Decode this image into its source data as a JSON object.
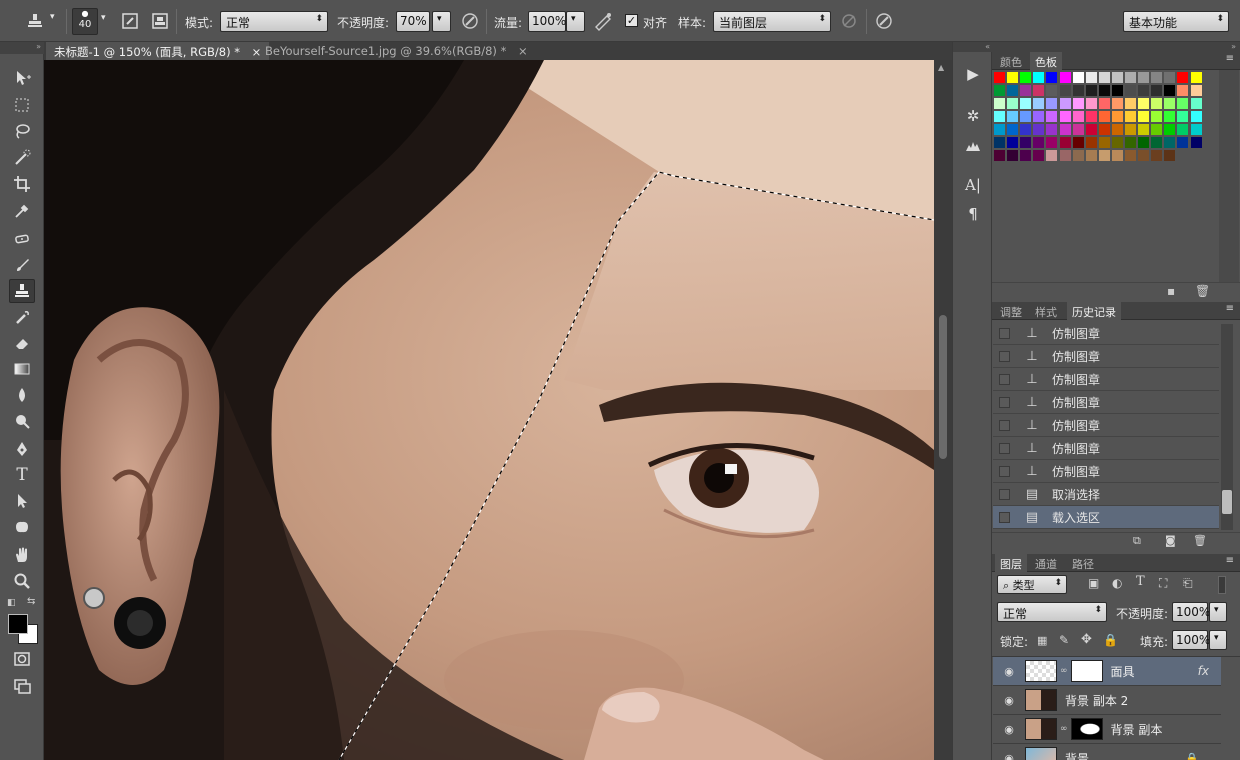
{
  "options_bar": {
    "brush_size": "40",
    "mode_label": "模式:",
    "mode_value": "正常",
    "opacity_label": "不透明度:",
    "opacity_value": "70%",
    "flow_label": "流量:",
    "flow_value": "100%",
    "aligned_label": "对齐",
    "sample_label": "样本:",
    "sample_value": "当前图层",
    "workspace": "基本功能"
  },
  "document_tabs": [
    {
      "title": "未标题-1 @ 150% (面具, RGB/8) *",
      "active": true
    },
    {
      "title": "BeYourself-Source1.jpg @ 39.6%(RGB/8) *",
      "active": false
    }
  ],
  "swatch_panel": {
    "tabs": [
      "颜色",
      "色板"
    ],
    "active_tab": "色板",
    "colors": [
      [
        "#ff0000",
        "#ffff00",
        "#00ff00",
        "#00ffff",
        "#0000ff",
        "#ff00ff",
        "#ffffff",
        "#ebebeb",
        "#d6d6d6",
        "#c2c2c2",
        "#adadad",
        "#999999",
        "#858585",
        "#707070",
        "#ff0000",
        "#ffff00"
      ],
      [
        "#009933",
        "#006699",
        "#993399",
        "#cc3366",
        "#5c5c5c",
        "#474747",
        "#333333",
        "#1f1f1f",
        "#0a0a0a",
        "#000000",
        "#4d4d4d",
        "#3d3d3d",
        "#2e2e2e",
        "#000000",
        "#ff8c66",
        "#ffcc99"
      ],
      [
        "#ccffcc",
        "#99ffcc",
        "#99ffff",
        "#99ccff",
        "#9999ff",
        "#cc99ff",
        "#ff99ff",
        "#ff99cc",
        "#ff6666",
        "#ff9966",
        "#ffcc66",
        "#ffff66",
        "#ccff66",
        "#99ff66",
        "#66ff66",
        "#66ffcc"
      ],
      [
        "#66ffff",
        "#66ccff",
        "#6699ff",
        "#9966ff",
        "#cc66ff",
        "#ff66ff",
        "#ff66cc",
        "#ff3366",
        "#ff6633",
        "#ff9933",
        "#ffcc33",
        "#ffff33",
        "#99ff33",
        "#33ff33",
        "#33ff99",
        "#33ffff"
      ],
      [
        "#0099cc",
        "#0066cc",
        "#3333cc",
        "#6633cc",
        "#9933cc",
        "#cc33cc",
        "#cc3399",
        "#cc0033",
        "#cc3300",
        "#cc6600",
        "#cc9900",
        "#cccc00",
        "#66cc00",
        "#00cc00",
        "#00cc66",
        "#00cccc"
      ],
      [
        "#003366",
        "#000099",
        "#330066",
        "#660066",
        "#990066",
        "#990033",
        "#660000",
        "#993300",
        "#996600",
        "#666600",
        "#336600",
        "#006600",
        "#006633",
        "#006666",
        "#003399",
        "#000066"
      ],
      [
        "#4d0033",
        "#330033",
        "#4d004d",
        "#66004d",
        "#cc9999",
        "#996666",
        "#8c6a4f",
        "#a67c52",
        "#c69c6d",
        "#ba8a5a",
        "#8a5a2e",
        "#7a4f2a",
        "#6b3f1f",
        "#5c3317"
      ]
    ]
  },
  "history_panel": {
    "tabs": [
      "调整",
      "样式",
      "历史记录"
    ],
    "active_tab": "历史记录",
    "items": [
      {
        "icon": "stamp-icon",
        "label": "仿制图章"
      },
      {
        "icon": "stamp-icon",
        "label": "仿制图章"
      },
      {
        "icon": "stamp-icon",
        "label": "仿制图章"
      },
      {
        "icon": "stamp-icon",
        "label": "仿制图章"
      },
      {
        "icon": "stamp-icon",
        "label": "仿制图章"
      },
      {
        "icon": "stamp-icon",
        "label": "仿制图章"
      },
      {
        "icon": "stamp-icon",
        "label": "仿制图章"
      },
      {
        "icon": "document-icon",
        "label": "取消选择"
      },
      {
        "icon": "document-icon",
        "label": "载入选区"
      }
    ],
    "selected_index": 8
  },
  "layers_panel": {
    "tabs": [
      "图层",
      "通道",
      "路径"
    ],
    "active_tab": "图层",
    "filter_label": "类型",
    "blend_mode": "正常",
    "opacity_label": "不透明度:",
    "opacity_value": "100%",
    "lock_label": "锁定:",
    "fill_label": "填充:",
    "fill_value": "100%",
    "layers": [
      {
        "name": "面具",
        "selected": true,
        "has_mask": true,
        "fx": "fx"
      },
      {
        "name": "背景 副本 2",
        "selected": false,
        "has_mask": false,
        "fx": ""
      },
      {
        "name": "背景 副本",
        "selected": false,
        "has_mask": true,
        "fx": ""
      },
      {
        "name": "背景",
        "selected": false,
        "has_mask": false,
        "fx": ""
      }
    ]
  },
  "colors": {
    "ui_bg": "#535353",
    "selected_row": "#5e6a7c",
    "skin": "#c9a187"
  }
}
